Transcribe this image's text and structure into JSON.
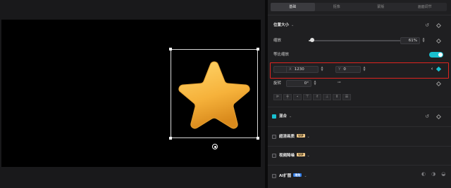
{
  "tabs": [
    {
      "label": "基础",
      "active": true
    },
    {
      "label": "抠像",
      "active": false
    },
    {
      "label": "蒙版",
      "active": false
    },
    {
      "label": "画面调节",
      "active": false
    }
  ],
  "position_size": {
    "title": "位置大小",
    "scale": {
      "label": "缩放",
      "value": "61%",
      "level": 0.61
    },
    "uniform_scale": {
      "label": "等比缩放",
      "enabled": true
    },
    "position": {
      "label": "位置",
      "x_prefix": "X",
      "x_value": "1230",
      "y_prefix": "Y",
      "y_value": "0"
    },
    "rotation": {
      "label": "旋转",
      "value": "0°"
    }
  },
  "blend": {
    "label": "混合",
    "checked": true
  },
  "features": [
    {
      "label": "超清画质",
      "badge": "VIP"
    },
    {
      "label": "视频降噪",
      "badge": "VIP"
    },
    {
      "label": "AI扩图",
      "badge": "限免"
    }
  ],
  "colors": {
    "accent": "#18c0d0",
    "highlight": "#e0241f",
    "star": "#f5b941"
  }
}
